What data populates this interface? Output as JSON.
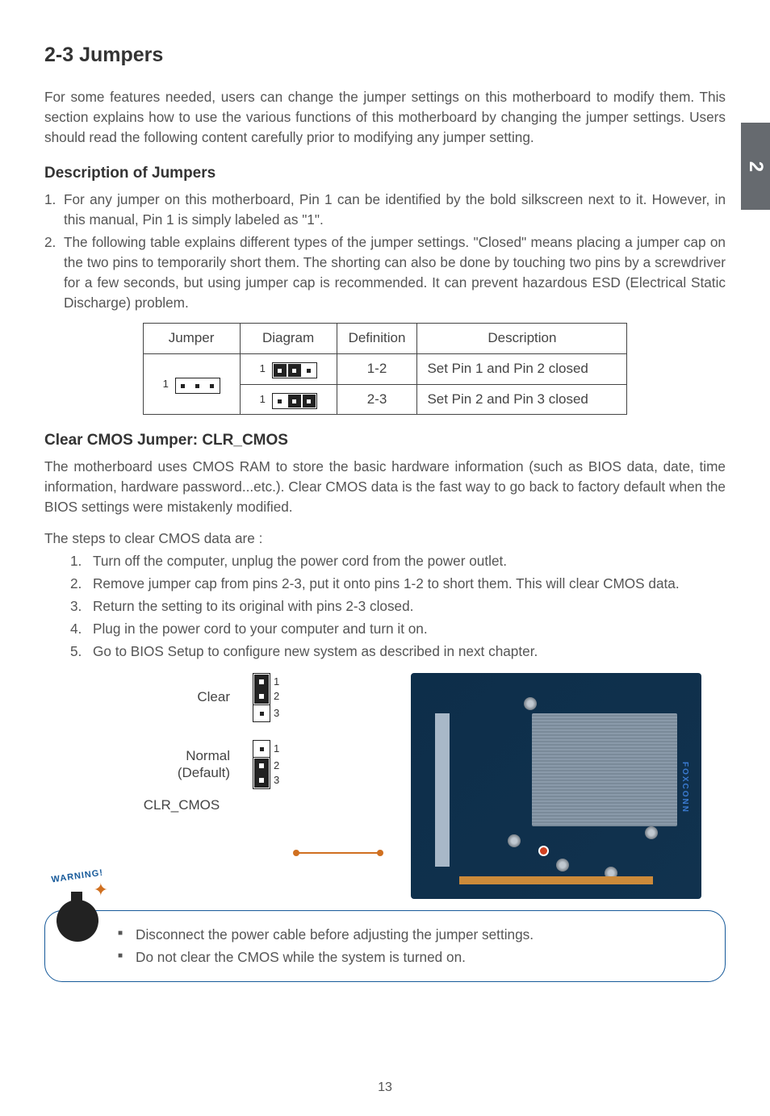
{
  "side_tab": "2",
  "title": "2-3 Jumpers",
  "intro": "For some features needed, users can change the jumper settings on this motherboard to modify them. This section explains how to use the various functions of this motherboard by changing the jumper settings. Users should read the following content carefully prior to modifying any jumper setting.",
  "desc_heading": "Description of Jumpers",
  "desc_items": [
    {
      "num": "1.",
      "text": "For any jumper on this motherboard, Pin 1 can be identified by the bold silkscreen next to it. However, in this manual, Pin 1 is simply labeled as \"1\"."
    },
    {
      "num": "2.",
      "text": "The following table explains different types of the jumper settings. \"Closed\" means placing a jumper cap on the two pins to temporarily short them. The shorting can also be done by touching two pins by a screwdriver for a few seconds, but using jumper cap is recommended. It can prevent hazardous ESD (Electrical Static Discharge) problem."
    }
  ],
  "table": {
    "headers": [
      "Jumper",
      "Diagram",
      "Definition",
      "Description"
    ],
    "row0_label": "1",
    "rows": [
      {
        "diag_label": "1",
        "definition": "1-2",
        "description": "Set Pin 1 and Pin 2 closed"
      },
      {
        "diag_label": "1",
        "definition": "2-3",
        "description": "Set Pin 2 and Pin 3 closed"
      }
    ]
  },
  "clear_heading": "Clear CMOS Jumper: CLR_CMOS",
  "clear_para": "The motherboard uses CMOS RAM to store the basic hardware information (such as BIOS data, date, time information, hardware password...etc.). Clear CMOS data is the fast way to go back to factory default when the BIOS settings were mistakenly modified.",
  "steps_intro": "The steps to clear CMOS data are :",
  "steps": [
    {
      "num": "1.",
      "text": "Turn off the computer, unplug the power cord from the power outlet."
    },
    {
      "num": "2.",
      "text": "Remove jumper cap from pins 2-3, put it onto pins 1-2 to short them. This will clear CMOS data."
    },
    {
      "num": "3.",
      "text": "Return the setting to its original with pins 2-3 closed."
    },
    {
      "num": "4.",
      "text": "Plug in the power cord to your computer and turn it on."
    },
    {
      "num": "5.",
      "text": "Go to BIOS Setup to configure new system as described in next chapter."
    }
  ],
  "diagram": {
    "clear_label": "Clear",
    "normal_label_1": "Normal",
    "normal_label_2": "(Default)",
    "pin1": "1",
    "pin2": "2",
    "pin3": "3",
    "clr_label": "CLR_CMOS",
    "board_brand": "FOXCONN"
  },
  "warning": {
    "badge": "WARNING!",
    "items": [
      "Disconnect the power cable before adjusting the jumper settings.",
      "Do not clear the CMOS while the system is turned on."
    ]
  },
  "page_num": "13"
}
